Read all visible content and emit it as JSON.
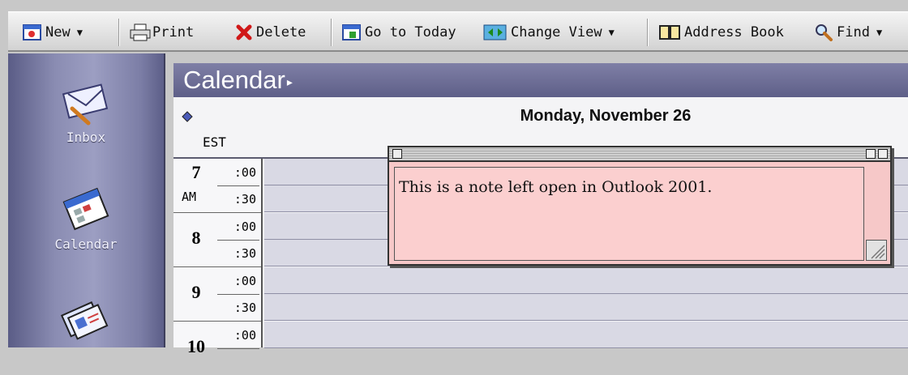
{
  "toolbar": {
    "new_label": "New",
    "print_label": "Print",
    "delete_label": "Delete",
    "go_to_today_label": "Go to Today",
    "change_view_label": "Change View",
    "address_book_label": "Address Book",
    "find_label": "Find"
  },
  "sidebar": {
    "items": [
      {
        "label": "Inbox",
        "icon": "inbox-envelope-icon"
      },
      {
        "label": "Calendar",
        "icon": "calendar-icon"
      },
      {
        "label": "",
        "icon": "address-cards-icon"
      }
    ]
  },
  "calendar": {
    "header_title": "Calendar",
    "day_title": "Monday, November 26",
    "timezone": "EST",
    "hours": [
      {
        "hour": "7",
        "ampm": "AM",
        "m1": ":00",
        "m2": ":30"
      },
      {
        "hour": "8",
        "ampm": "",
        "m1": ":00",
        "m2": ":30"
      },
      {
        "hour": "9",
        "ampm": "",
        "m1": ":00",
        "m2": ":30"
      },
      {
        "hour": "10",
        "ampm": "",
        "m1": ":00",
        "m2": ""
      }
    ]
  },
  "note": {
    "text": "This is a note left open in Outlook 2001."
  },
  "colors": {
    "sidebar": "#8a8cb2",
    "header": "#6e6f98",
    "slot": "#d9d9e4",
    "note": "#f6c8c8"
  }
}
